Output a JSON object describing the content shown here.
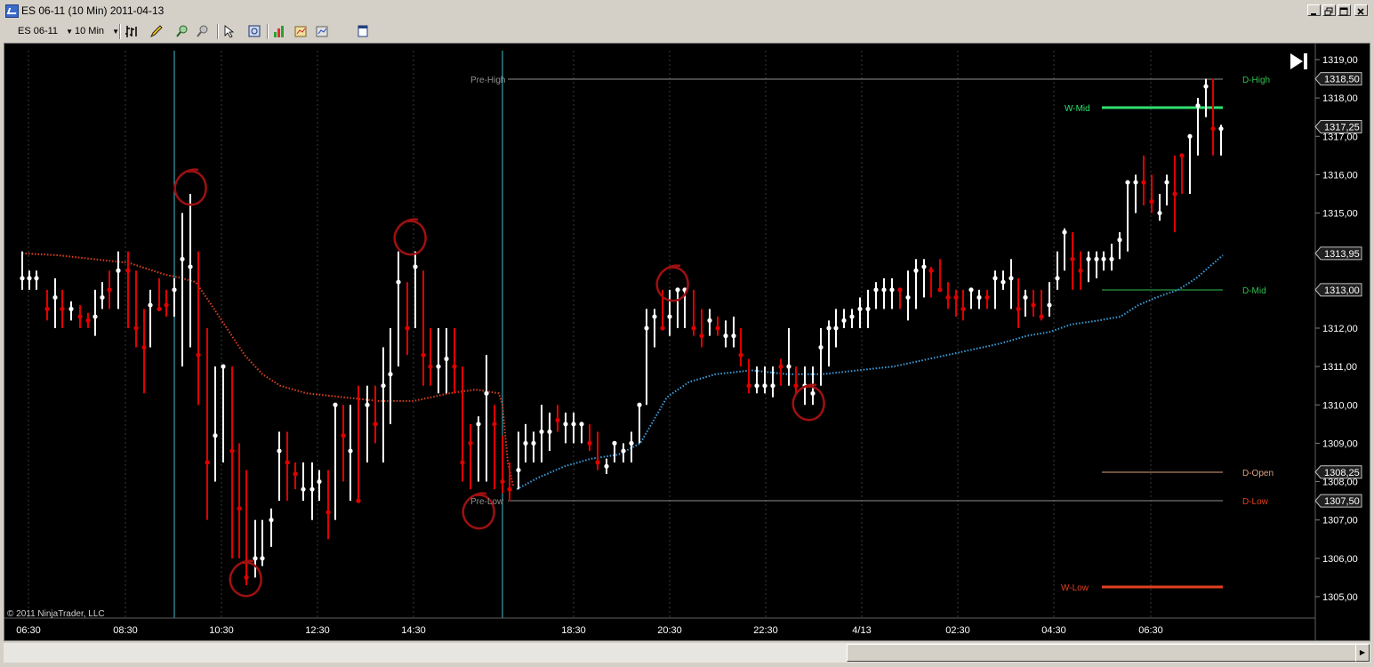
{
  "window": {
    "title": "ES 06-11 (10 Min)  2011-04-13"
  },
  "toolbar": {
    "instrument": "ES 06-11",
    "interval": "10 Min"
  },
  "chart": {
    "copyright": "© 2011 NinjaTrader, LLC",
    "time_labels": [
      "06:30",
      "08:30",
      "10:30",
      "12:30",
      "14:30",
      "18:30",
      "20:30",
      "22:30",
      "4/13",
      "02:30",
      "04:30",
      "06:30"
    ],
    "price_labels": [
      "1319,00",
      "1318,00",
      "1317,00",
      "1316,00",
      "1315,00",
      "1313,00",
      "1312,00",
      "1311,00",
      "1310,00",
      "1309,00",
      "1308,00",
      "1307,00",
      "1306,00",
      "1305,00"
    ],
    "price_markers": [
      "1318,50",
      "1317,25",
      "1313,95",
      "1313,00",
      "1308,25",
      "1307,50"
    ],
    "level_labels": {
      "pre_high": "Pre-High",
      "pre_low": "Pre-Low",
      "d_high": "D-High",
      "w_mid": "W-Mid",
      "d_mid": "D-Mid",
      "d_open": "D-Open",
      "d_low": "D-Low",
      "w_low": "W-Low"
    },
    "colors": {
      "up_bar": "#ffffff",
      "down_bar": "#e00000",
      "vwap_prior": "#e04020",
      "vwap_current": "#3aa0e0",
      "session_line": "#40c0d0",
      "d_high": "#30c050",
      "w_mid": "#30e070",
      "d_mid": "#30c050",
      "d_open": "#e0a080",
      "d_low": "#e04020",
      "w_low": "#e04020",
      "annotation_circle": "#a01010"
    },
    "price_range": [
      1304.5,
      1319.2
    ]
  }
}
